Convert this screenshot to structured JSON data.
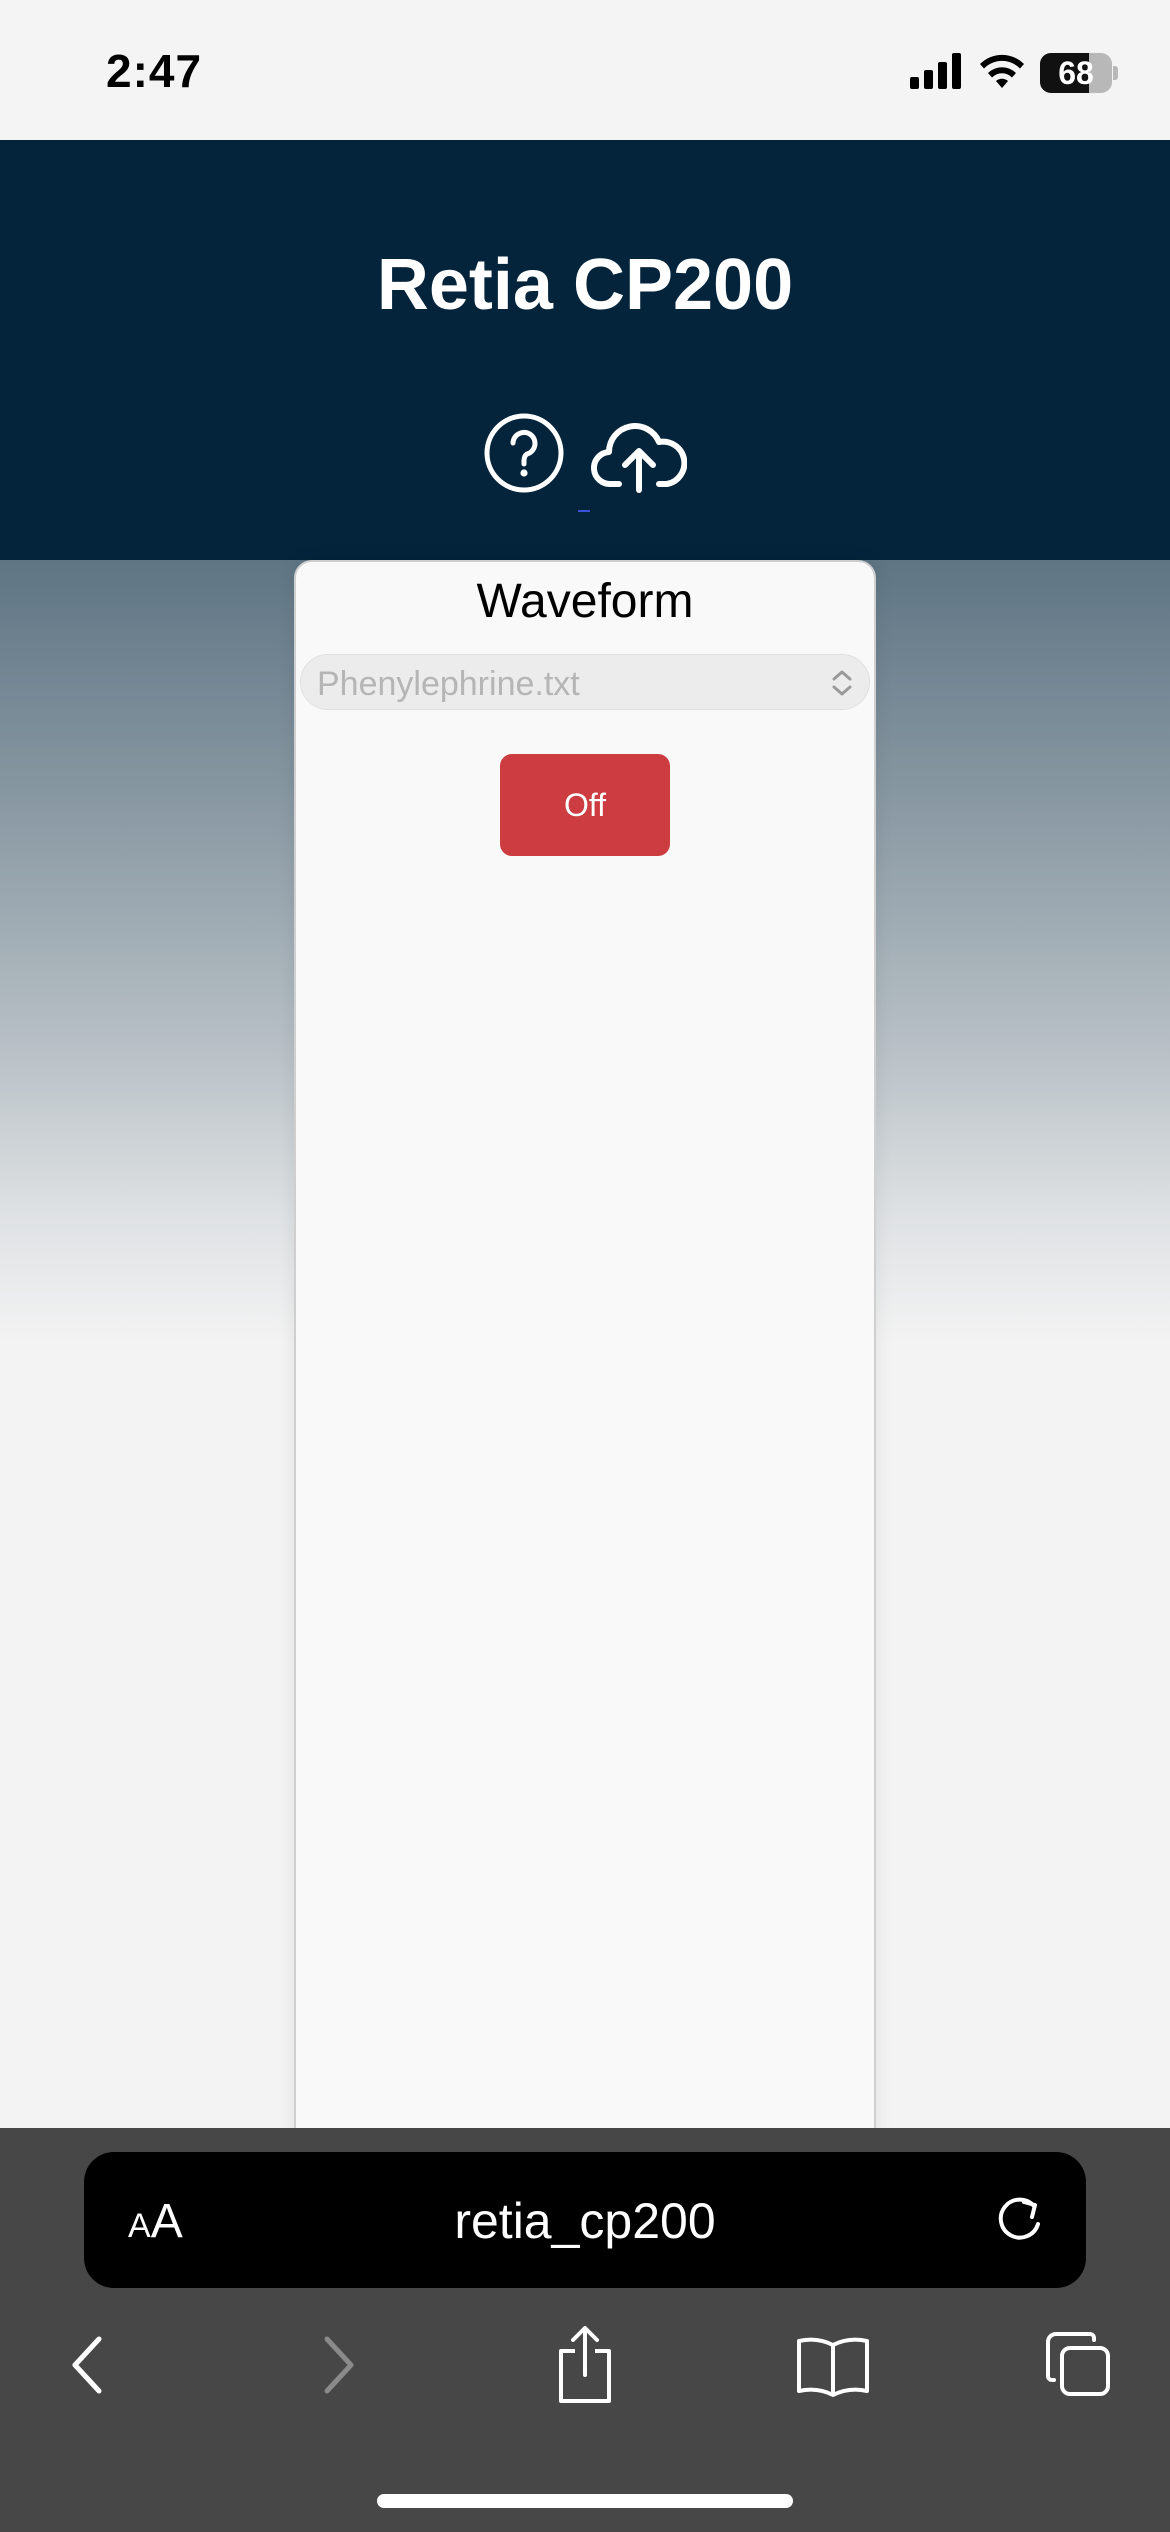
{
  "status_bar": {
    "time": "2:47",
    "battery_level": "68",
    "battery_fraction": 0.68,
    "icons": [
      "cellular-signal-icon",
      "wifi-icon",
      "battery-icon"
    ]
  },
  "header": {
    "title": "Retia CP200",
    "icons": [
      "help-icon",
      "cloud-upload-icon"
    ]
  },
  "panel": {
    "title": "Waveform",
    "waveform_select": {
      "value": "Phenylephrine.txt"
    },
    "toggle_button": {
      "label": "Off",
      "color": "#cc3c40"
    }
  },
  "browser": {
    "text_size_label_small": "A",
    "text_size_label_large": "A",
    "url": "retia_cp200",
    "icons": [
      "reload-icon",
      "back-icon",
      "forward-icon",
      "share-icon",
      "bookmarks-icon",
      "tabs-icon"
    ]
  },
  "colors": {
    "header_bg": "#03243a",
    "browser_bar_bg": "#474747",
    "off_button": "#cc3c40"
  }
}
